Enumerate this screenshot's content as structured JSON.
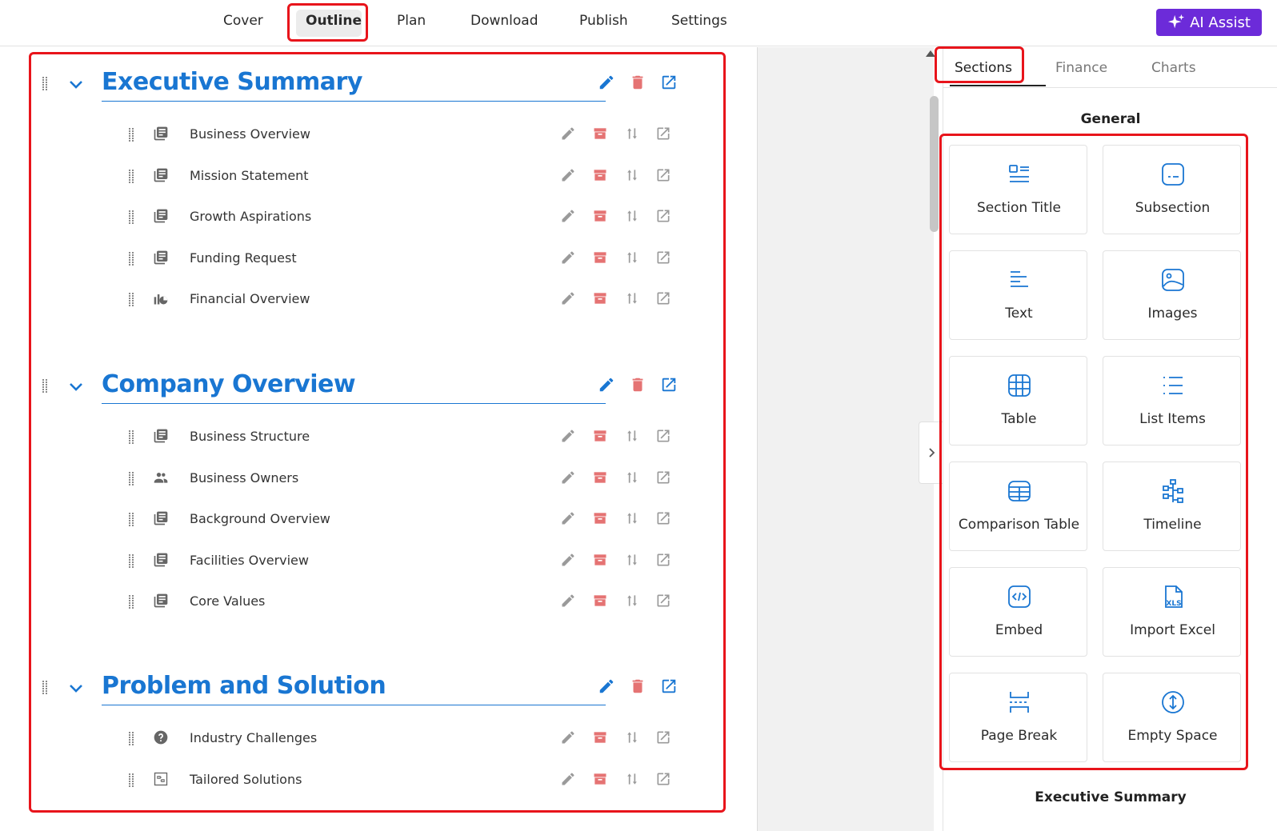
{
  "nav": {
    "items": [
      "Cover",
      "Outline",
      "Plan",
      "Download",
      "Publish",
      "Settings"
    ],
    "active": "Outline",
    "ai_assist_label": "AI Assist"
  },
  "outline": {
    "sections": [
      {
        "title": "Executive Summary",
        "items": [
          {
            "label": "Business Overview",
            "icon": "document-icon"
          },
          {
            "label": "Mission Statement",
            "icon": "document-icon"
          },
          {
            "label": "Growth Aspirations",
            "icon": "document-icon"
          },
          {
            "label": "Funding Request",
            "icon": "document-icon"
          },
          {
            "label": "Financial Overview",
            "icon": "chart-icon"
          }
        ]
      },
      {
        "title": "Company Overview",
        "items": [
          {
            "label": "Business Structure",
            "icon": "document-icon"
          },
          {
            "label": "Business Owners",
            "icon": "people-icon"
          },
          {
            "label": "Background Overview",
            "icon": "document-icon"
          },
          {
            "label": "Facilities Overview",
            "icon": "document-icon"
          },
          {
            "label": "Core Values",
            "icon": "document-icon"
          }
        ]
      },
      {
        "title": "Problem and Solution",
        "items": [
          {
            "label": "Industry Challenges",
            "icon": "help-icon"
          },
          {
            "label": "Tailored Solutions",
            "icon": "puzzle-icon"
          }
        ]
      }
    ]
  },
  "right_panel": {
    "tabs": [
      "Sections",
      "Finance",
      "Charts"
    ],
    "active_tab": "Sections",
    "group_title": "General",
    "tiles": [
      {
        "label": "Section Title",
        "icon": "section-title-icon"
      },
      {
        "label": "Subsection",
        "icon": "subsection-icon"
      },
      {
        "label": "Text",
        "icon": "text-icon"
      },
      {
        "label": "Images",
        "icon": "image-icon"
      },
      {
        "label": "Table",
        "icon": "table-icon"
      },
      {
        "label": "List Items",
        "icon": "list-icon"
      },
      {
        "label": "Comparison Table",
        "icon": "comparison-table-icon"
      },
      {
        "label": "Timeline",
        "icon": "timeline-icon"
      },
      {
        "label": "Embed",
        "icon": "embed-icon"
      },
      {
        "label": "Import Excel",
        "icon": "excel-icon"
      },
      {
        "label": "Page Break",
        "icon": "page-break-icon"
      },
      {
        "label": "Empty Space",
        "icon": "empty-space-icon"
      }
    ],
    "next_group_title": "Executive Summary"
  },
  "colors": {
    "accent_blue": "#1976d2",
    "delete_red": "#e57373",
    "ai_purple": "#6c2bd9",
    "highlight_red": "#e8141b"
  }
}
